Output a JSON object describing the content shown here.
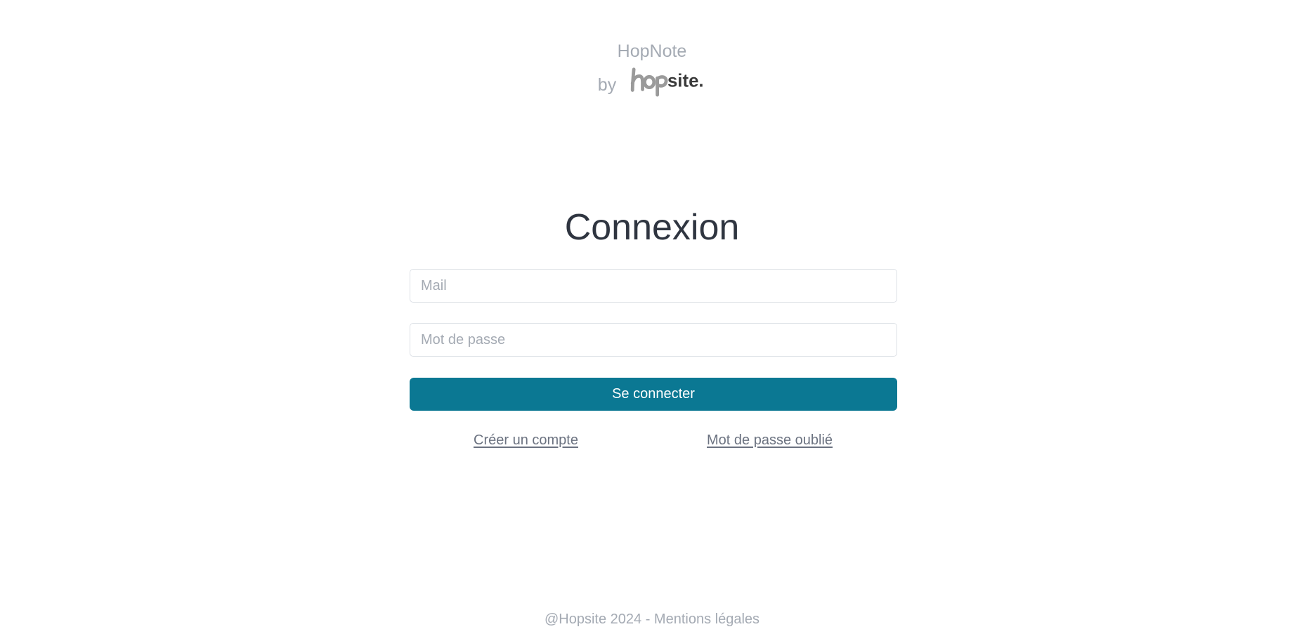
{
  "brand": {
    "app_name": "HopNote",
    "by_label": "by",
    "logo_text": "hopsite.",
    "logo_icon": "hopsite-logo"
  },
  "login": {
    "title": "Connexion",
    "mail_placeholder": "Mail",
    "mail_value": "",
    "password_placeholder": "Mot de passe",
    "password_value": "",
    "submit_label": "Se connecter",
    "create_account_label": "Créer un compte",
    "forgot_password_label": "Mot de passe oublié"
  },
  "footer": {
    "copyright": "@Hopsite 2024",
    "separator": " - ",
    "legal_label": "Mentions légales"
  },
  "colors": {
    "accent": "#0b7893",
    "muted_text": "#a4aab3",
    "title_text": "#2f3540",
    "link_text": "#6b7280",
    "logo_grey": "#9a9a9a",
    "logo_dark": "#3a3a3a"
  }
}
